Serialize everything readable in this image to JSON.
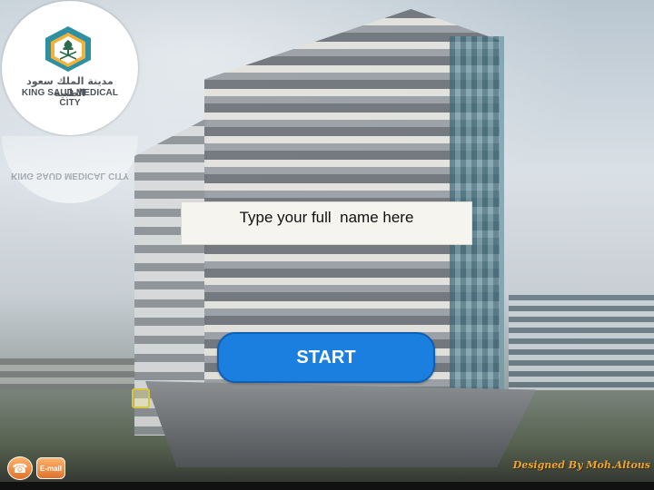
{
  "logo": {
    "arabic_text": "مدينة الملك سعود الطبية",
    "english_text": "KING SAUD MEDICAL CITY",
    "reflection_text": "KING SAUD MEDICAL CITY",
    "icon": "emblem-icon",
    "colors": {
      "hex_outer": "#2f8fa3",
      "hex_inner": "#f2b23a"
    }
  },
  "name_input": {
    "placeholder": "Type your full  name here",
    "value": ""
  },
  "start_button": {
    "label": "START",
    "color": "#1b7fe0"
  },
  "contact": {
    "phone_icon": "phone-icon",
    "phone_glyph": "☎",
    "email_label": "E-mail"
  },
  "credit": "Designed By Moh.Altous"
}
